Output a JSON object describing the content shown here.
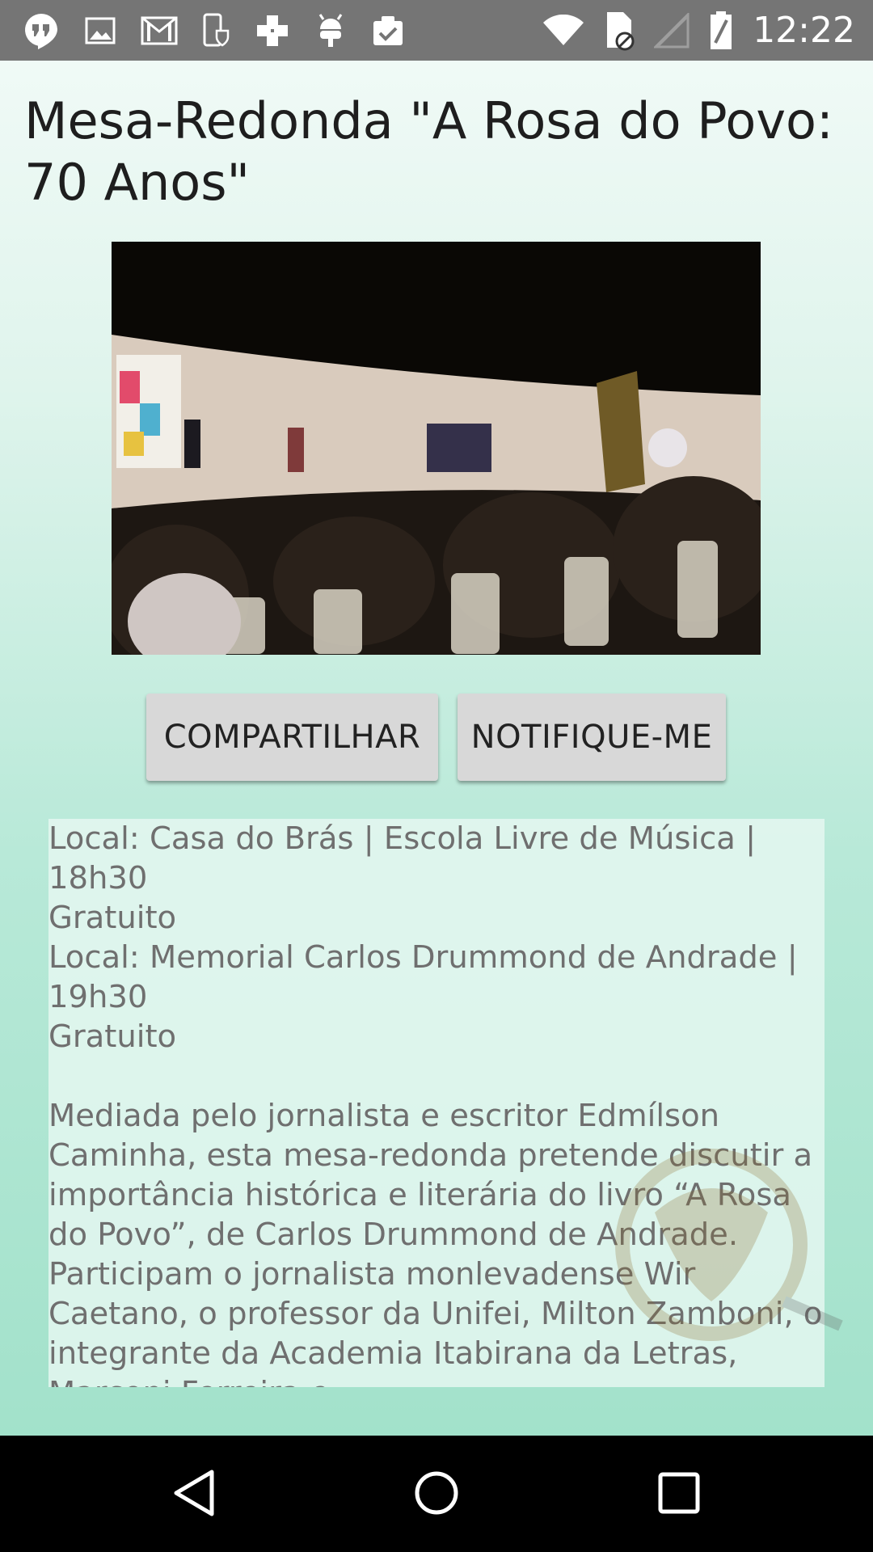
{
  "status_bar": {
    "time": "12:22",
    "left_icons": [
      "hangouts-icon",
      "gallery-icon",
      "gmail-icon",
      "phone-shield-icon",
      "plus-cross-icon",
      "android-icon",
      "clipboard-check-icon"
    ],
    "right_icons": [
      "wifi-icon",
      "sim-blocked-icon",
      "signal-icon",
      "battery-icon"
    ]
  },
  "event": {
    "title": "Mesa-Redonda \"A Rosa do Povo: 70 Anos\"",
    "image_icon": "event-photo"
  },
  "actions": {
    "share_label": "COMPARTILHAR",
    "notify_label": "NOTIFIQUE-ME"
  },
  "details": {
    "lines": [
      "Local: Casa do Brás | Escola Livre de Música |",
      "18h30",
      "Gratuito",
      "Local: Memorial Carlos Drummond de Andrade |",
      "19h30",
      "Gratuito"
    ],
    "description": "Mediada pelo jornalista e escritor Edmílson Caminha, esta mesa-redonda pretende discutir a importância histórica e literária do livro “A Rosa do Povo”, de Carlos Drummond de Andrade. Participam o jornalista monlevadense Wir Caetano, o professor da Unifei, Milton Zamboni, o integrante da Academia Itabirana da Letras, Marconi Ferreira e"
  },
  "colors": {
    "status_bar": "#757575",
    "background_top": "#f3fbf8",
    "background_bottom": "#9ee0c8",
    "button": "#d8d8d8",
    "nav_bar": "#000000"
  },
  "nav": {
    "icons": [
      "back-icon",
      "home-icon",
      "recents-icon"
    ]
  }
}
